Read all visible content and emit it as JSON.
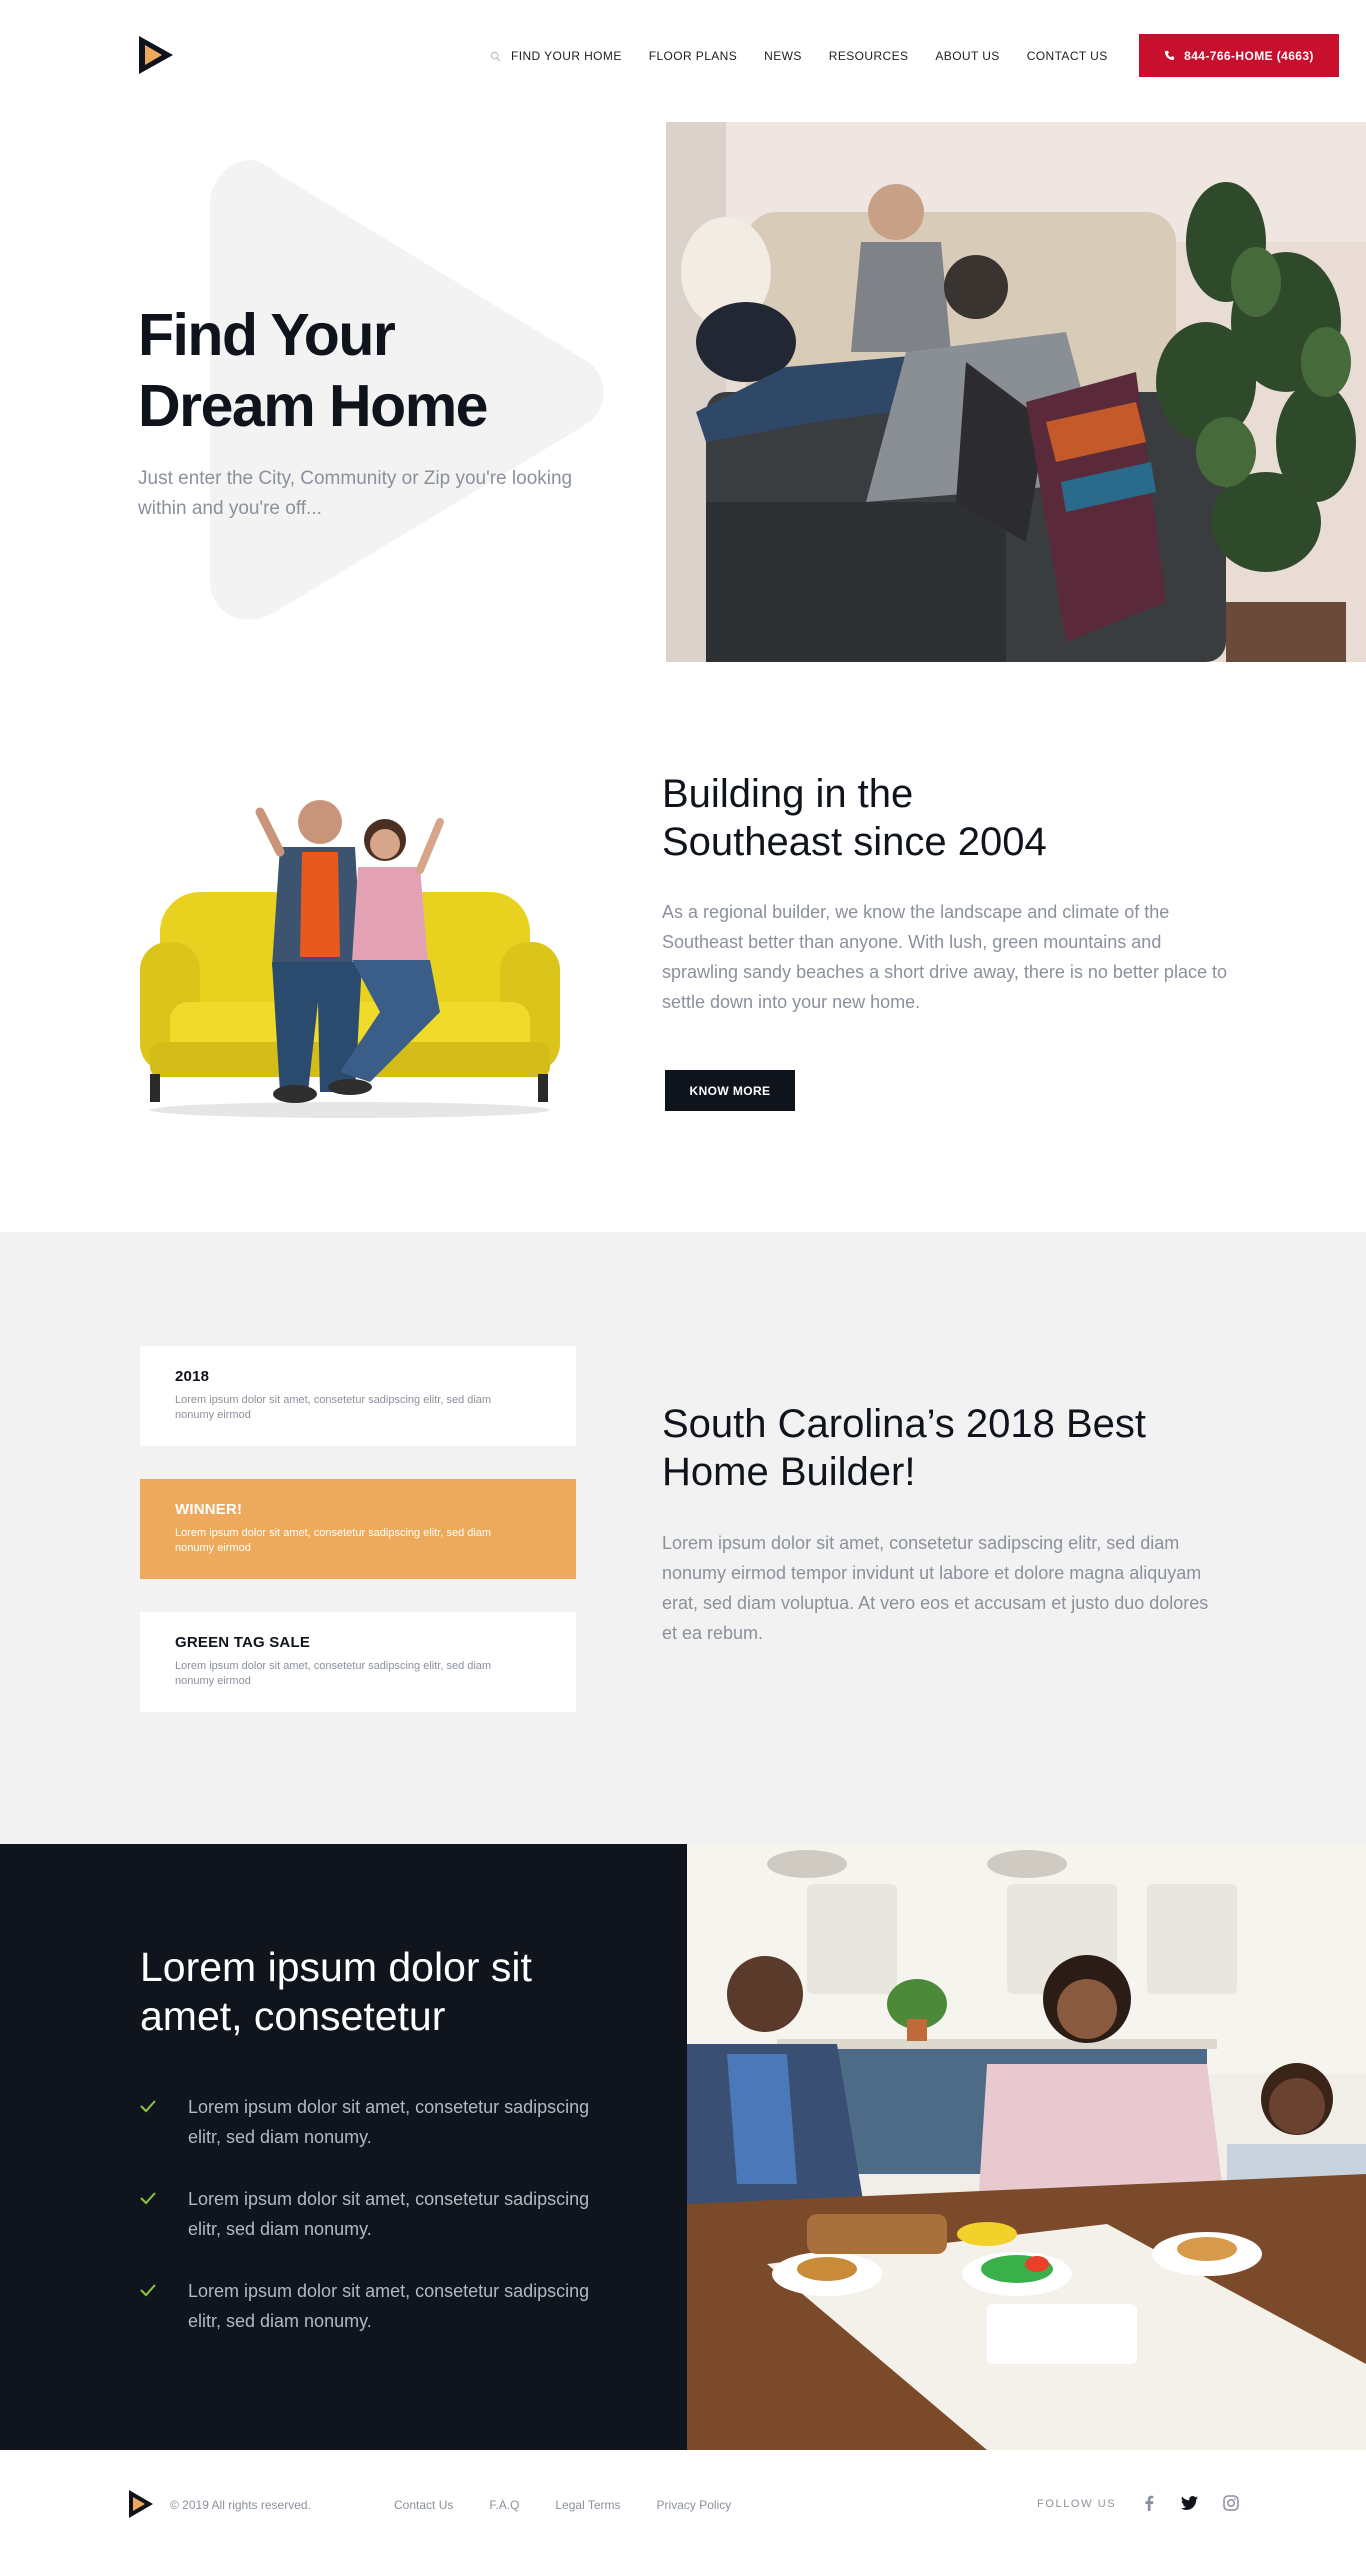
{
  "header": {
    "nav": [
      "FIND YOUR HOME",
      "FLOOR PLANS",
      "NEWS",
      "RESOURCES",
      "ABOUT US",
      "CONTACT US"
    ],
    "phone": "844-766-HOME (4663)"
  },
  "hero": {
    "title_line1": "Find Your",
    "title_line2": "Dream Home",
    "subtitle": "Just enter the City, Community or Zip you're looking within and you're off..."
  },
  "building": {
    "title_line1": "Building in the",
    "title_line2": "Southeast since 2004",
    "text": "As a regional builder, we know the landscape and climate of the Southeast better than anyone. With lush, green mountains and sprawling sandy beaches a short drive away, there is no better place to settle down into your new home.",
    "button": "KNOW MORE"
  },
  "awards": {
    "cards": [
      {
        "title": "2018",
        "text": "Lorem ipsum dolor sit amet, consetetur sadipscing elitr, sed diam nonumy eirmod"
      },
      {
        "title": "WINNER!",
        "text": "Lorem ipsum dolor sit amet, consetetur sadipscing elitr, sed diam nonumy eirmod"
      },
      {
        "title": "GREEN TAG SALE",
        "text": "Lorem ipsum dolor sit amet, consetetur sadipscing elitr, sed diam nonumy eirmod"
      }
    ],
    "title_line1": "South Carolina’s 2018 Best",
    "title_line2": "Home Builder!",
    "text": "Lorem ipsum dolor sit amet, consetetur sadipscing elitr, sed diam nonumy eirmod tempor invidunt ut labore et dolore magna aliquyam erat, sed diam voluptua. At vero eos et accusam et justo duo dolores et ea rebum."
  },
  "features": {
    "title_line1": "Lorem ipsum dolor sit",
    "title_line2": "amet, consetetur",
    "items": [
      "Lorem ipsum dolor sit amet, consetetur sadipscing elitr, sed diam nonumy.",
      "Lorem ipsum dolor sit amet, consetetur sadipscing elitr, sed diam nonumy.",
      "Lorem ipsum dolor sit amet, consetetur sadipscing elitr, sed diam nonumy."
    ]
  },
  "footer": {
    "copyright": "© 2019 All rights reserved.",
    "links": [
      "Contact Us",
      "F.A.Q",
      "Legal Terms",
      "Privacy Policy"
    ],
    "follow": "FOLLOW US"
  },
  "colors": {
    "brand_red": "#c8102e",
    "brand_orange": "#edaa5c",
    "dark": "#10151d"
  },
  "icons": [
    "logo-play-icon",
    "search-icon",
    "phone-icon",
    "check-icon",
    "facebook-icon",
    "twitter-icon",
    "instagram-icon"
  ]
}
